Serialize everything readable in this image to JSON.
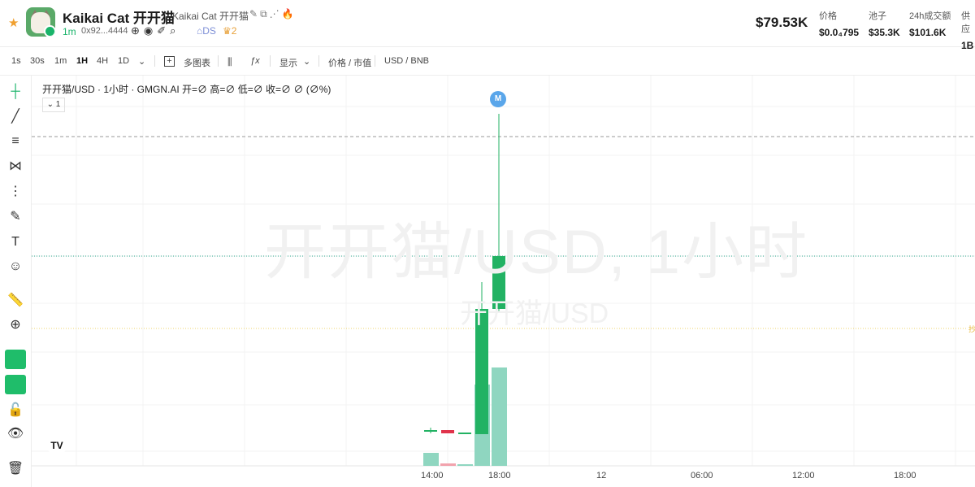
{
  "token": {
    "name": "Kaikai Cat 开开猫",
    "subtitle": "Kaikai Cat 开开猫",
    "age": "1m",
    "address": "0x92...4444",
    "ds_label": "DS",
    "holders_count": "2",
    "market_cap": "$79.53K"
  },
  "stats": [
    {
      "label": "价格",
      "value": "$0.0₄795"
    },
    {
      "label": "池子",
      "value": "$35.3K"
    },
    {
      "label": "24h成交额",
      "value": "$101.6K"
    },
    {
      "label": "供应",
      "value": "1B"
    }
  ],
  "toolbar": {
    "intervals": [
      "1s",
      "30s",
      "1m",
      "1H",
      "4H",
      "1D"
    ],
    "active_interval": "1H",
    "multi_chart": "多图表",
    "display": "显示",
    "price_toggle": "价格 / 市值",
    "currency_toggle": "USD / BNB"
  },
  "chart": {
    "legend": "开开猫/USD · 1小时 · GMGN.AI  开=∅  高=∅  低=∅  收=∅  ∅ (∅%)",
    "collapse_label": "1",
    "watermark_main": "开开猫/USD, 1小时",
    "watermark_sub": "开开猫/USD",
    "marker": "M",
    "tv_logo": "TV",
    "right_label": "抄",
    "x_labels": [
      "14:00",
      "18:00",
      "12",
      "06:00",
      "12:00",
      "18:00"
    ],
    "colors": {
      "up": "#22b263",
      "down": "#e0334b",
      "volume_up": "#8fd6c0",
      "volume_down": "#f2a3ad"
    }
  },
  "chart_data": {
    "type": "candlestick",
    "candles": [
      {
        "dir": "up",
        "vol": "low"
      },
      {
        "dir": "down",
        "vol": "low"
      },
      {
        "dir": "up",
        "vol": "low"
      },
      {
        "dir": "up",
        "vol": "high"
      },
      {
        "dir": "up",
        "vol": "high"
      }
    ]
  }
}
